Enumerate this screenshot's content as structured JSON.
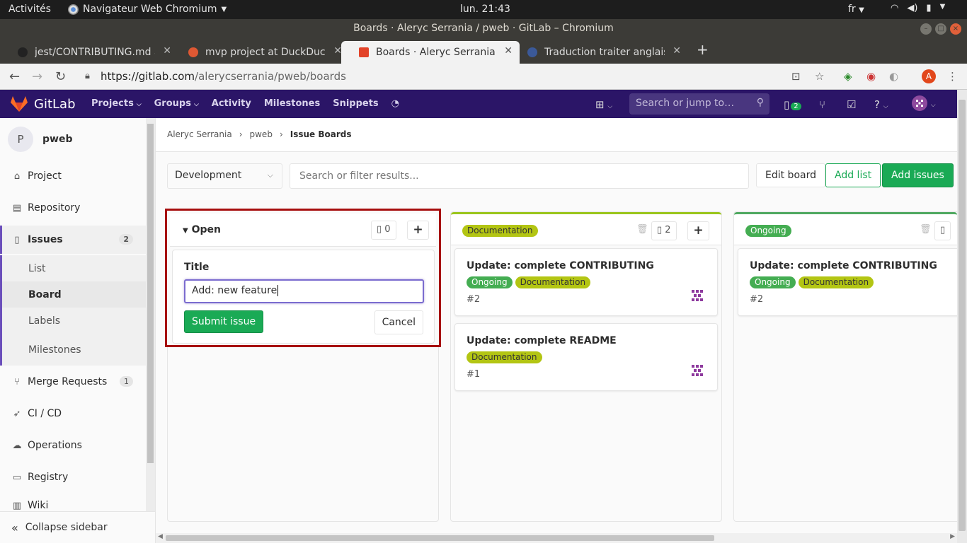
{
  "os": {
    "activities": "Activités",
    "app_name": "Navigateur Web Chromium",
    "clock": "lun. 21:43",
    "lang": "fr"
  },
  "window": {
    "title": "Boards · Aleryc Serrania / pweb · GitLab – Chromium"
  },
  "tabs": [
    {
      "title": "jest/CONTRIBUTING.md a",
      "favicon_color": "#222222"
    },
    {
      "title": "mvp project at DuckDuck",
      "favicon_color": "#de5833"
    },
    {
      "title": "Boards · Aleryc Serrania /",
      "favicon_color": "#e24329"
    },
    {
      "title": "Traduction traiter anglais",
      "favicon_color": "#3b5998"
    }
  ],
  "omnibox": {
    "url_host": "https://gitlab.com",
    "url_path": "/alerycserrania/pweb/boards",
    "profile_initial": "A"
  },
  "gitlab_nav": {
    "brand": "GitLab",
    "menu": [
      "Projects",
      "Groups",
      "Activity",
      "Milestones",
      "Snippets"
    ],
    "search_placeholder": "Search or jump to…",
    "issues_count": "2"
  },
  "sidebar": {
    "project_initial": "P",
    "project_name": "pweb",
    "items": {
      "project": "Project",
      "repository": "Repository",
      "issues": "Issues",
      "issues_count": "2",
      "list": "List",
      "board": "Board",
      "labels": "Labels",
      "milestones": "Milestones",
      "merge_requests": "Merge Requests",
      "merge_requests_count": "1",
      "cicd": "CI / CD",
      "operations": "Operations",
      "registry": "Registry",
      "wiki": "Wiki"
    },
    "collapse": "Collapse sidebar"
  },
  "breadcrumb": {
    "owner": "Aleryc Serrania",
    "project": "pweb",
    "current": "Issue Boards"
  },
  "toolbar": {
    "board_name": "Development",
    "filter_placeholder": "Search or filter results...",
    "edit_board": "Edit board",
    "add_list": "Add list",
    "add_issues": "Add issues"
  },
  "lists": {
    "open": {
      "title": "Open",
      "count": "0",
      "form": {
        "label": "Title",
        "value": "Add: new feature",
        "submit": "Submit issue",
        "cancel": "Cancel"
      }
    },
    "documentation": {
      "label": "Documentation",
      "count": "2",
      "cards": [
        {
          "title": "Update: complete CONTRIBUTING",
          "labels": [
            "Ongoing",
            "Documentation"
          ],
          "number": "#2"
        },
        {
          "title": "Update: complete README",
          "labels": [
            "Documentation"
          ],
          "number": "#1"
        }
      ]
    },
    "ongoing": {
      "label": "Ongoing",
      "cards": [
        {
          "title": "Update: complete CONTRIBUTING",
          "labels": [
            "Ongoing",
            "Documentation"
          ],
          "number": "#2"
        }
      ]
    }
  },
  "colors": {
    "gitlab_nav": "#2b1567",
    "primary_green": "#1aaa55",
    "doc_label": "#b3c513",
    "ongoing_label": "#44ad52",
    "highlight_border": "#a60d0d"
  }
}
